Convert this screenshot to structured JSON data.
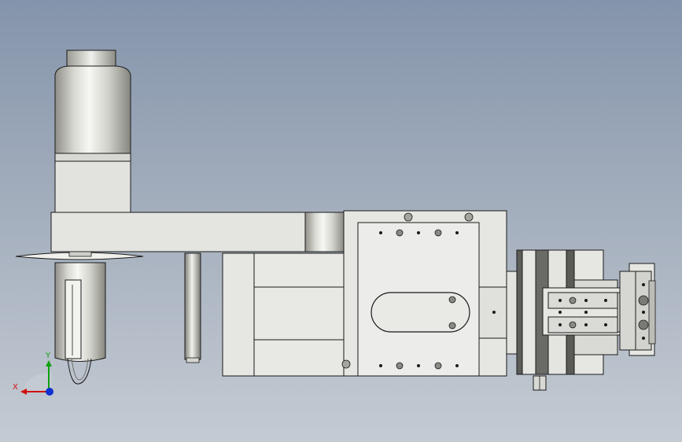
{
  "viewport": {
    "background_top": "#8494ab",
    "background_bottom": "#c4cbd3"
  },
  "model": {
    "part_color": "#e8e8e4",
    "edge_color": "#1a1a1a",
    "metal_light": "#f4f4f0",
    "metal_dark": "#8a8a84"
  },
  "triad": {
    "x_label": "X",
    "y_label": "Y",
    "x_color": "#d01010",
    "y_color": "#10a010",
    "z_color": "#1030d0"
  }
}
